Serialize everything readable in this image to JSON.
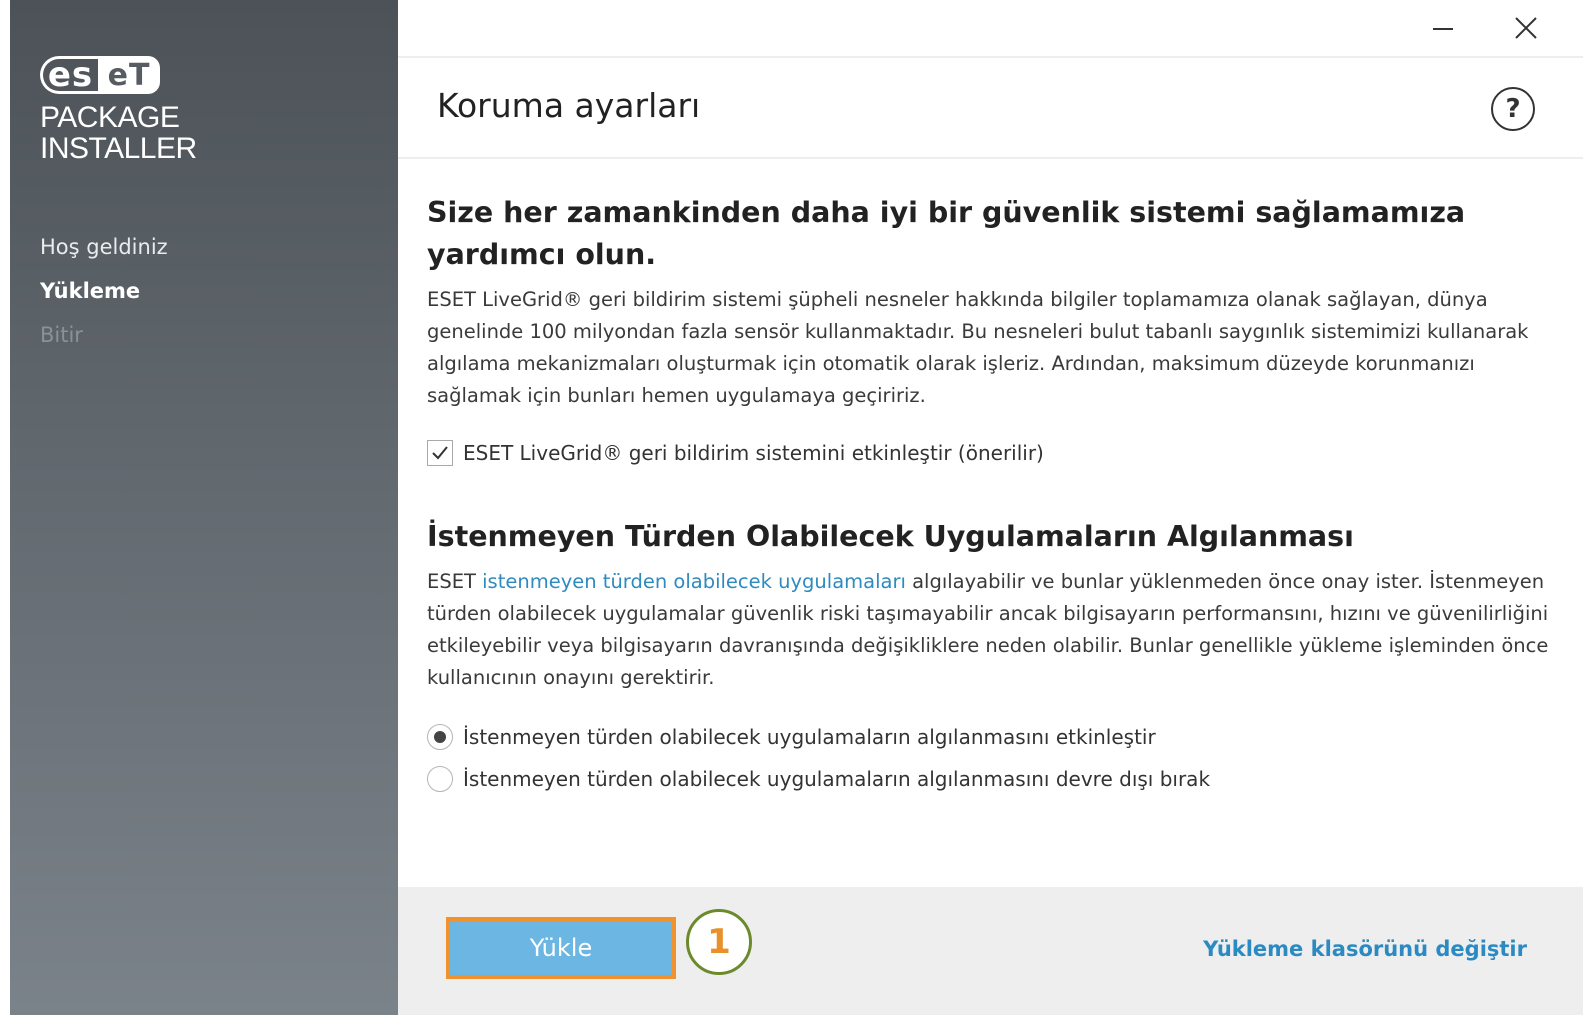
{
  "sidebar": {
    "logo": {
      "left": "es",
      "right": "eT"
    },
    "product_line1": "PACKAGE",
    "product_line2": "INSTALLER",
    "items": [
      {
        "label": "Hoş geldiniz",
        "state": "done"
      },
      {
        "label": "Yükleme",
        "state": "active"
      },
      {
        "label": "Bitir",
        "state": "disabled"
      }
    ]
  },
  "window": {
    "minimize_icon": "minimize-icon",
    "close_icon": "close-icon"
  },
  "header": {
    "title": "Koruma ayarları",
    "help_glyph": "?"
  },
  "livegrid": {
    "heading": "Size her zamankinden daha iyi bir güvenlik sistemi sağlamamıza yardımcı olun.",
    "description": "ESET LiveGrid® geri bildirim sistemi şüpheli nesneler hakkında bilgiler toplamamıza olanak sağlayan, dünya genelinde 100 milyondan fazla sensör kullanmaktadır. Bu nesneleri bulut tabanlı saygınlık sistemimizi kullanarak algılama mekanizmaları oluşturmak için otomatik olarak işleriz. Ardından, maksimum düzeyde korunmanızı sağlamak için bunları hemen uygulamaya geçiririz.",
    "checkbox_label": "ESET LiveGrid® geri bildirim sistemini etkinleştir (önerilir)",
    "checkbox_checked": true
  },
  "pua": {
    "heading": "İstenmeyen Türden Olabilecek Uygulamaların Algılanması",
    "desc_prefix": "ESET ",
    "desc_link": "istenmeyen türden olabilecek uygulamaları",
    "desc_rest": " algılayabilir ve bunlar yüklenmeden önce onay ister. İstenmeyen türden olabilecek uygulamalar güvenlik riski taşımayabilir ancak bilgisayarın performansını, hızını ve güvenilirliğini etkileyebilir veya bilgisayarın davranışında değişikliklere neden olabilir. Bunlar genellikle yükleme işleminden önce kullanıcının onayını gerektirir.",
    "options": [
      {
        "label": "İstenmeyen türden olabilecek uygulamaların algılanmasını etkinleştir",
        "selected": true
      },
      {
        "label": "İstenmeyen türden olabilecek uygulamaların algılanmasını devre dışı bırak",
        "selected": false
      }
    ]
  },
  "footer": {
    "install_label": "Yükle",
    "callout_number": "1",
    "change_folder_label": "Yükleme klasörünü değiştir"
  },
  "colors": {
    "accent_link": "#2e8bc0",
    "install_button": "#6bb6e3",
    "highlight_border": "#f0922e",
    "callout_border": "#6b8a2c",
    "callout_text": "#e8902a"
  }
}
